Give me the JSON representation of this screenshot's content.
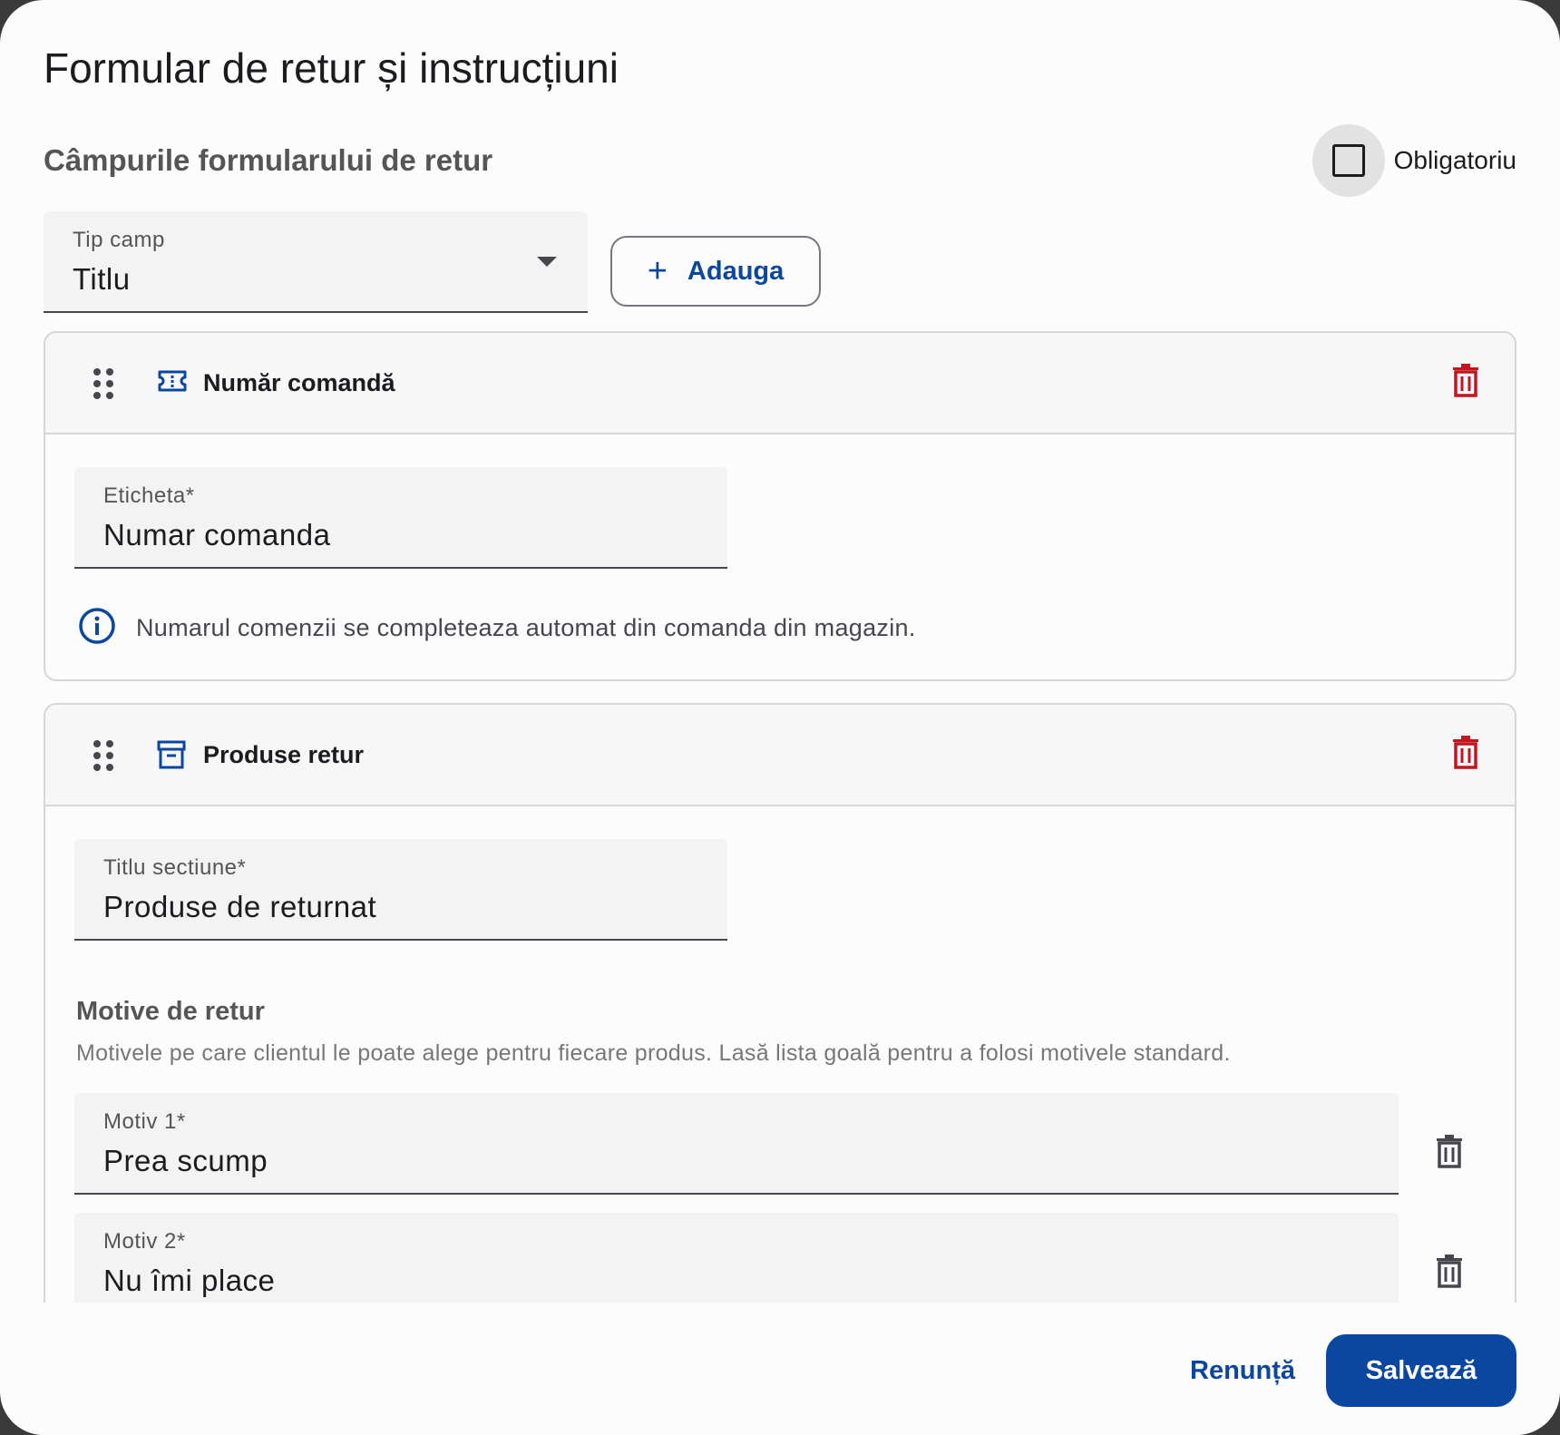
{
  "dialog": {
    "title": "Formular de retur și instrucțiuni",
    "section_title": "Câmpurile formularului de retur",
    "required_label": "Obligatoriu",
    "required_checked": false
  },
  "field_type": {
    "label": "Tip camp",
    "value": "Titlu",
    "add_label": "Adauga"
  },
  "cards": [
    {
      "title": "Număr comandă",
      "icon": "ticket-icon",
      "field_label": "Eticheta*",
      "field_value": "Numar comanda",
      "info": "Numarul comenzii se completeaza automat din comanda din magazin."
    },
    {
      "title": "Produse retur",
      "icon": "archive-icon",
      "field_label": "Titlu sectiune*",
      "field_value": "Produse de returnat",
      "reasons_title": "Motive de retur",
      "reasons_desc": "Motivele pe care clientul le poate alege pentru fiecare produs. Lasă lista goală pentru a folosi motivele standard.",
      "reasons": [
        {
          "label": "Motiv 1*",
          "value": "Prea scump"
        },
        {
          "label": "Motiv 2*",
          "value": "Nu îmi place"
        }
      ]
    }
  ],
  "footer": {
    "cancel_label": "Renunță",
    "save_label": "Salvează"
  },
  "colors": {
    "primary": "#0b47a1",
    "danger": "#c4141d"
  }
}
